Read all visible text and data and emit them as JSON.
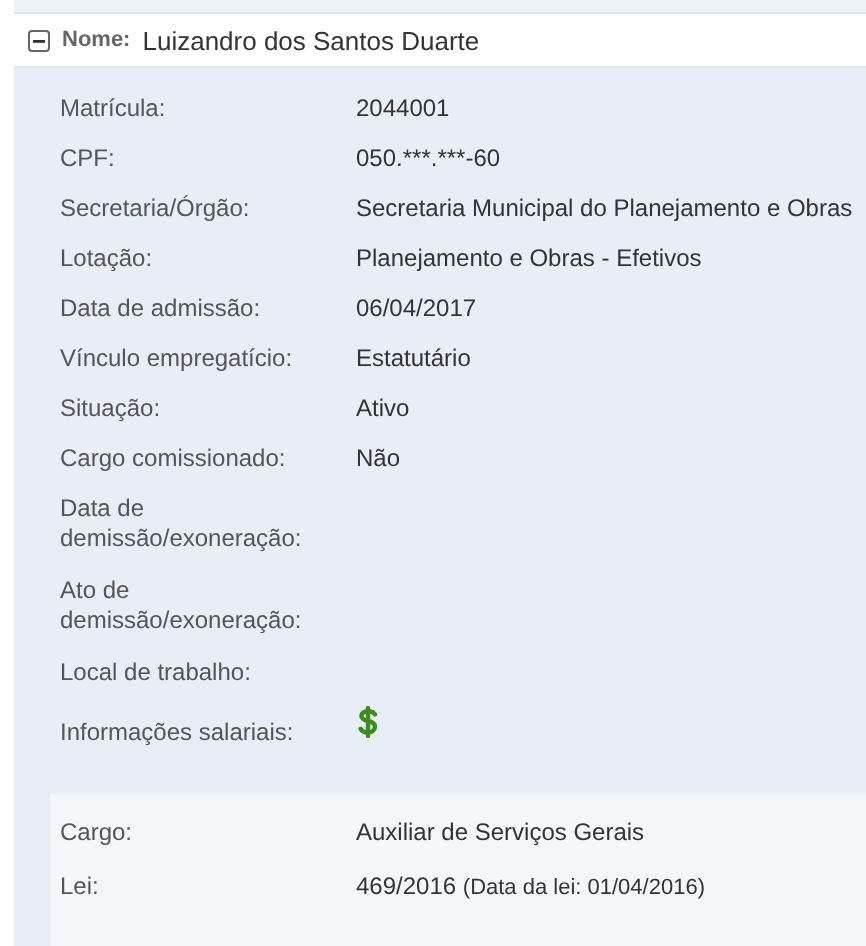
{
  "header": {
    "expanded": true,
    "label": "Nome:",
    "value": "Luizandro dos Santos Duarte"
  },
  "fields": [
    {
      "kind": "text",
      "label": "Matrícula:",
      "value": "2044001"
    },
    {
      "kind": "text",
      "label": "CPF:",
      "value": "050.***.***-60"
    },
    {
      "kind": "text",
      "label": "Secretaria/Órgão:",
      "value": "Secretaria Municipal do Planejamento e Obras"
    },
    {
      "kind": "text",
      "label": "Lotação:",
      "value": "Planejamento e Obras - Efetivos"
    },
    {
      "kind": "text",
      "label": "Data de admissão:",
      "value": "06/04/2017"
    },
    {
      "kind": "text",
      "label": "Vínculo empregatício:",
      "value": "Estatutário"
    },
    {
      "kind": "text",
      "label": "Situação:",
      "value": "Ativo"
    },
    {
      "kind": "text",
      "label": "Cargo comissionado:",
      "value": "Não"
    },
    {
      "kind": "text",
      "label": "Data de demissão/exoneração:"
    },
    {
      "kind": "text",
      "label": "Ato de demissão/exoneração:"
    },
    {
      "kind": "text",
      "label": "Local de trabalho:"
    },
    {
      "kind": "salary",
      "label": "Informações salariais:"
    }
  ],
  "cargo_fields": [
    {
      "label": "Cargo:",
      "value": "Auxiliar de Serviços Gerais"
    },
    {
      "label": "Lei:",
      "value": "469/2016",
      "note": "(Data da lei: 01/04/2016)"
    }
  ]
}
